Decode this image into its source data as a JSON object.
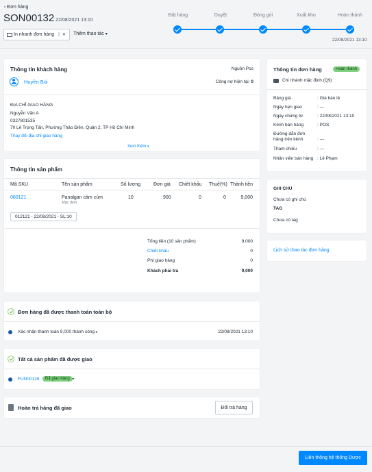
{
  "header": {
    "back_label": "Đơn hàng",
    "order_code": "SON00132",
    "order_date": "22/08/2021 13:10",
    "print_label": "In nhanh đơn hàng",
    "more_label": "Thêm thao tác"
  },
  "progress": {
    "steps": [
      "Đặt hàng",
      "Duyệt",
      "Đóng gói",
      "Xuất kho",
      "Hoàn thành"
    ],
    "done_date": "22/08/2021 13:10"
  },
  "customer": {
    "title": "Thông tin khách hàng",
    "source": "Nguồn Pos",
    "name": "Huyền Bùi",
    "debt_label": "Công nợ hiện tại:",
    "debt_value": "0",
    "address_title": "ĐỊA CHỈ GIAO HÀNG",
    "recipient": "Nguyễn Văn A",
    "phone": "0327801535",
    "address": "70 Lê Trọng Tấn, Phường Thảo Điền, Quận 2, TP Hồ Chí Minh",
    "change_address": "Thay đổi địa chỉ giao hàng",
    "more": "Xem thêm"
  },
  "products": {
    "title": "Thông tin sản phẩm",
    "columns": [
      "Mã SKU",
      "Tên sản phẩm",
      "Số lượng",
      "Đơn giá",
      "Chiết khấu",
      "Thuế(%)",
      "Thành tiền"
    ],
    "row": {
      "sku": "080121",
      "name": "Panalgan cảm cúm",
      "variant": "Mặc định",
      "qty": "10",
      "price": "900",
      "discount": "0",
      "tax": "0",
      "total": "9,000"
    },
    "lot": "012121 - 22/08/2021 - SL:10"
  },
  "summary": {
    "total_label": "Tổng tiền (10 sản phẩm)",
    "total_value": "9,000",
    "discount_label": "Chiết khấu",
    "discount_value": "0",
    "ship_label": "Phí giao hàng",
    "ship_value": "0",
    "pay_label": "Khách phải trả",
    "pay_value": "9,000"
  },
  "payment": {
    "title": "Đơn hàng đã được thanh toán toàn bộ",
    "entry": "Xác nhận thanh toán 9,000 thành công",
    "entry_date": "22/08/2021 13:10"
  },
  "delivery": {
    "title": "Tất cả sản phẩm đã được giao",
    "code": "FUN00128",
    "status": "Đã giao hàng"
  },
  "return": {
    "title": "Hoàn trả hàng đã giao",
    "button": "Đổi trả hàng"
  },
  "order_info": {
    "title": "Thông tin đơn hàng",
    "status": "Hoàn thành",
    "branch": "Chi nhánh mặc định (Q9)",
    "fields": [
      {
        "label": "Bảng giá",
        "value": ": Giá bán lẻ"
      },
      {
        "label": "Ngày hẹn giao",
        "value": ": ---"
      },
      {
        "label": "Ngày chứng từ",
        "value": ": 22/08/2021 13:10"
      },
      {
        "label": "Kênh bán hàng",
        "value": ": POS"
      },
      {
        "label": "Đường dẫn đơn hàng trên kênh",
        "value": ": ---"
      },
      {
        "label": "Tham chiếu",
        "value": ": ---"
      },
      {
        "label": "Nhân viên bán hàng",
        "value": ": Lê Phạm"
      }
    ]
  },
  "notes": {
    "note_title": "GHI CHÚ",
    "note_value": "Chưa có ghi chú",
    "tag_title": "TAG",
    "tag_value": "Chưa có tag"
  },
  "history": {
    "label": "Lịch sử thao tác đơn hàng"
  },
  "footer": {
    "connect_button": "Liên thông hệ thống Dược"
  },
  "colors": {
    "accent": "#0088ff",
    "success": "#7fd17f",
    "background": "#f3f4f6"
  }
}
